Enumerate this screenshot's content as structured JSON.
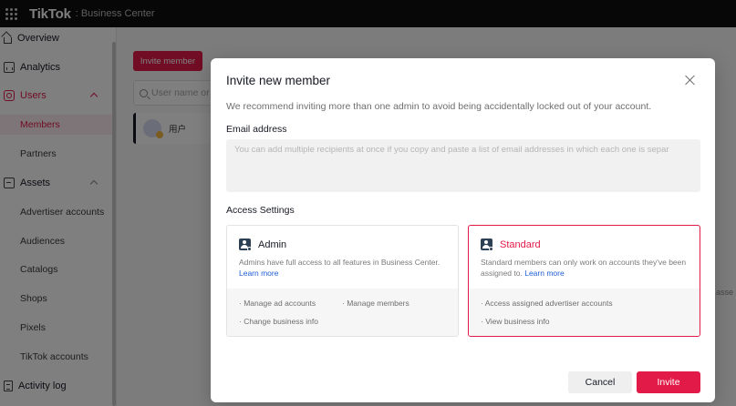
{
  "topbar": {
    "brand": "TikTok",
    "separator": ":",
    "product": "Business Center"
  },
  "sidebar": {
    "overview": "Overview",
    "analytics": "Analytics",
    "users": "Users",
    "members": "Members",
    "partners": "Partners",
    "assets": "Assets",
    "advertiser_accounts": "Advertiser accounts",
    "audiences": "Audiences",
    "catalogs": "Catalogs",
    "shops": "Shops",
    "pixels": "Pixels",
    "tiktok_accounts": "TikTok accounts",
    "activity_log": "Activity log"
  },
  "background": {
    "invite_button": "Invite member",
    "search_placeholder": "User name or e",
    "member_name": "用户",
    "right_edge_text": "asse"
  },
  "modal": {
    "title": "Invite new member",
    "description": "We recommend inviting more than one admin to avoid being accidentally locked out of your account.",
    "email_label": "Email address",
    "email_placeholder": "You can add multiple recipients at once if you copy and paste a list of email addresses in which each one is separ",
    "access_label": "Access Settings",
    "admin": {
      "name": "Admin",
      "description": "Admins have full access to all features in Business Center.",
      "learn_more": "Learn more",
      "permissions": [
        "Manage ad accounts",
        "Manage members",
        "Change business info"
      ]
    },
    "standard": {
      "name": "Standard",
      "description": "Standard members can only work on accounts they've been assigned to.",
      "learn_more": "Learn more",
      "permissions": [
        "Access assigned advertiser accounts",
        "View business info"
      ],
      "selected": true
    },
    "cancel_label": "Cancel",
    "invite_label": "Invite"
  },
  "colors": {
    "accent": "#e21a48",
    "link": "#1c5bd6",
    "topbar": "#0f0f0f"
  }
}
